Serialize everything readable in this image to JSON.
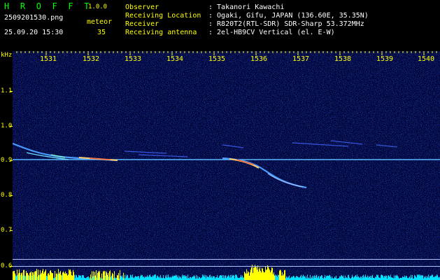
{
  "header": {
    "app_name": "H R O F F T",
    "version": "1.0.0",
    "filename": "2509201530.png",
    "datetime": "25.09.20 15:30",
    "meteor_label": "meteor",
    "meteor_count": "35",
    "info": [
      {
        "key": "Observer",
        "value": ": Takanori Kawachi"
      },
      {
        "key": "Receiving Location",
        "value": ": Ogaki, Gifu, JAPAN (136.60E, 35.35N)"
      },
      {
        "key": "Receiver",
        "value": ": R820T2(RTL-SDR) SDR-Sharp 53.372MHz"
      },
      {
        "key": "Receiving antenna",
        "value": ": 2el-HB9CV Vertical (el. E-W)"
      }
    ]
  },
  "axes": {
    "unit": "kHz",
    "x_labels": [
      "1531",
      "1532",
      "1533",
      "1534",
      "1535",
      "1536",
      "1537",
      "1538",
      "1539",
      "1540"
    ],
    "y_labels": [
      "1.1",
      "1.0",
      "0.9",
      "0.8",
      "0.7",
      "0.6"
    ]
  },
  "colors": {
    "label": "#ffff00",
    "background": "#000438",
    "carrier": "#33aaff",
    "meteor_hot": "#ffcc66",
    "noise_bar": "#00e0ff",
    "echo_bar": "#ffff00"
  }
}
